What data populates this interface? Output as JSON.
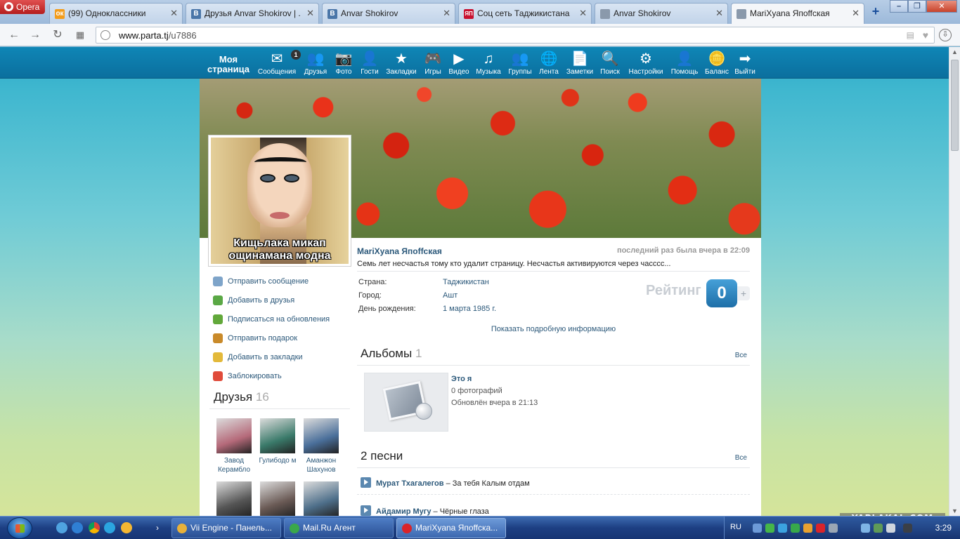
{
  "browser": {
    "menu_label": "Opera",
    "tabs": [
      {
        "title": "(99) Одноклассники",
        "favicon": "ok-icon",
        "favicon_color": "#f39c1a",
        "favicon_text": "ок"
      },
      {
        "title": "Друзья Anvar Shokirov | ...",
        "favicon": "vk-icon",
        "favicon_color": "#4a76a8",
        "favicon_text": "В"
      },
      {
        "title": "Anvar Shokirov",
        "favicon": "vk-icon",
        "favicon_color": "#4a76a8",
        "favicon_text": "В"
      },
      {
        "title": "Соц сеть Таджикистана",
        "favicon": "yaplakal-icon",
        "favicon_color": "#c8102e",
        "favicon_text": "ЯП"
      },
      {
        "title": "Anvar Shokirov",
        "favicon": "page-icon",
        "favicon_color": "#8a99ab",
        "favicon_text": ""
      },
      {
        "title": "MariXyana Япоffская",
        "favicon": "page-icon",
        "favicon_color": "#8a99ab",
        "favicon_text": ""
      }
    ],
    "url_domain": "www.parta.tj",
    "url_path": "/u7886"
  },
  "site": {
    "my_page_label": "Моя страница",
    "menu": [
      {
        "label": "Сообщения",
        "icon": "envelope-icon",
        "glyph": "✉",
        "badge": "1"
      },
      {
        "label": "Друзья",
        "icon": "friends-icon",
        "glyph": "👥"
      },
      {
        "label": "Фото",
        "icon": "camera-icon",
        "glyph": "📷"
      },
      {
        "label": "Гости",
        "icon": "guest-icon",
        "glyph": "👤"
      },
      {
        "label": "Закладки",
        "icon": "star-icon",
        "glyph": "★"
      },
      {
        "label": "Игры",
        "icon": "gamepad-icon",
        "glyph": "🎮"
      },
      {
        "label": "Видео",
        "icon": "play-icon",
        "glyph": "▶"
      },
      {
        "label": "Музыка",
        "icon": "music-icon",
        "glyph": "♫"
      },
      {
        "label": "Группы",
        "icon": "groups-icon",
        "glyph": "👥"
      },
      {
        "label": "Лента",
        "icon": "globe-icon",
        "glyph": "🌐"
      },
      {
        "label": "Заметки",
        "icon": "note-icon",
        "glyph": "📄"
      },
      {
        "label": "Поиск",
        "icon": "search-icon",
        "glyph": "🔍"
      },
      {
        "label": "Настройки",
        "icon": "gear-icon",
        "glyph": "⚙"
      },
      {
        "label": "Помощь",
        "icon": "help-icon",
        "glyph": "👤"
      },
      {
        "label": "Баланс",
        "icon": "coins-icon",
        "glyph": "🪙"
      },
      {
        "label": "Выйти",
        "icon": "arrow-right-icon",
        "glyph": "➡"
      }
    ]
  },
  "profile": {
    "avatar_caption": "Кищьлака микап ощинамана модна",
    "name": "MariXyana Япоffская",
    "last_seen": "последний раз была вчера в 22:09",
    "status": "Семь лет несчастья тому кто удалит страницу. Несчастья активируются через чассcс...",
    "info": [
      {
        "label": "Страна:",
        "value": "Таджикистан"
      },
      {
        "label": "Город:",
        "value": "Ашт"
      },
      {
        "label": "День рождения:",
        "value": "1 марта 1985 г."
      }
    ],
    "rating_label": "Рейтинг",
    "rating_value": "0",
    "show_more": "Показать подробную информацию",
    "actions": [
      {
        "label": "Отправить сообщение",
        "icon": "message-icon",
        "color": "#7ea4c9"
      },
      {
        "label": "Добавить в друзья",
        "icon": "add-friend-icon",
        "color": "#5aa845"
      },
      {
        "label": "Подписаться на обновления",
        "icon": "subscribe-icon",
        "color": "#62a83a"
      },
      {
        "label": "Отправить подарок",
        "icon": "gift-icon",
        "color": "#c98a2a"
      },
      {
        "label": "Добавить в закладки",
        "icon": "bookmark-icon",
        "color": "#e3b93a"
      },
      {
        "label": "Заблокировать",
        "icon": "block-icon",
        "color": "#e04b3a"
      }
    ],
    "friends_title": "Друзья",
    "friends_count": "16",
    "friends": [
      {
        "name": "Завод Керамбло",
        "color": "#b56a7a"
      },
      {
        "name": "Гулибодо м",
        "color": "#3a7a6a"
      },
      {
        "name": "Аманжон Шахунов",
        "color": "#4a6f9a"
      },
      {
        "name": "",
        "color": "#555"
      },
      {
        "name": "",
        "color": "#6a5a55"
      },
      {
        "name": "",
        "color": "#4e6f8a"
      }
    ],
    "albums_title": "Альбомы",
    "albums_count": "1",
    "albums_all": "Все",
    "album": {
      "title": "Это я",
      "photos": "0 фотографий",
      "updated": "Обновлён вчера в 21:13"
    },
    "songs_title": "2 песни",
    "songs_all": "Все",
    "songs": [
      {
        "artist": "Мурат Тхагалегов",
        "title": " – За тебя Калым отдам"
      },
      {
        "artist": "Айдамир Мугу",
        "title": " – Чёрные глаза"
      }
    ]
  },
  "taskbar": {
    "items": [
      {
        "label": "Vii Engine - Панель...",
        "icon": "chrome-icon",
        "color": "#e8b13a"
      },
      {
        "label": "Mail.Ru Агент",
        "icon": "mailru-agent-icon",
        "color": "#3aa84a"
      },
      {
        "label": "MariXyana Япоffска...",
        "icon": "opera-icon",
        "color": "#d9242a"
      }
    ],
    "lang": "RU",
    "clock": "3:29"
  },
  "watermark": "YAPLAKAL.COM"
}
